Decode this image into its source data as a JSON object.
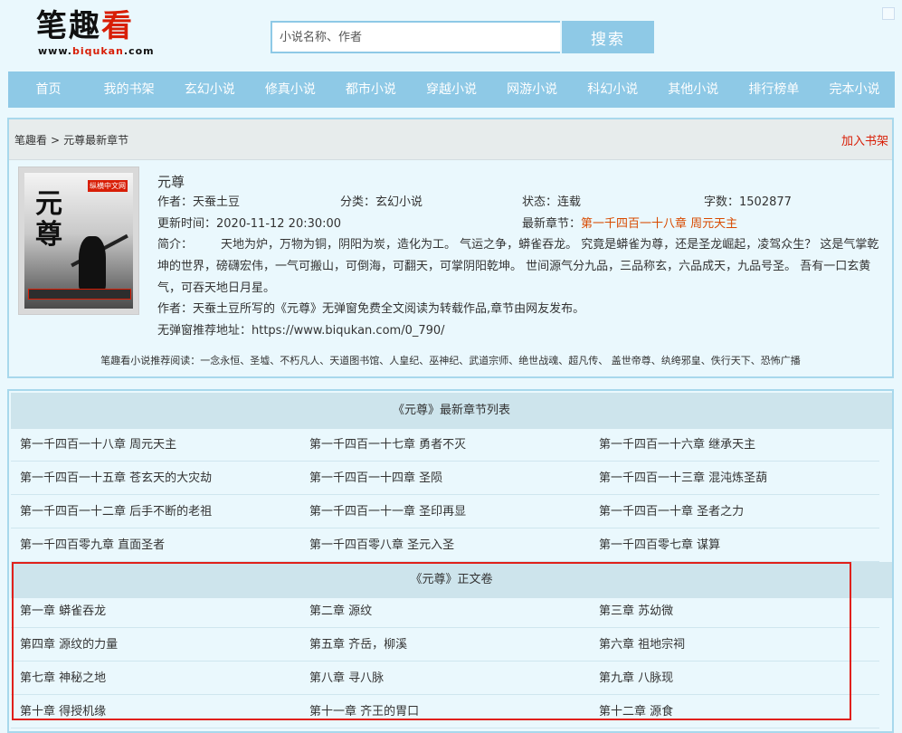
{
  "logo": {
    "cn_part1": "笔趣",
    "cn_part2": "看",
    "url_part1": "www.",
    "url_part2": "biqukan",
    "url_part3": ".com"
  },
  "search": {
    "placeholder": "小说名称、作者",
    "button": "搜索"
  },
  "nav": [
    "首页",
    "我的书架",
    "玄幻小说",
    "修真小说",
    "都市小说",
    "穿越小说",
    "网游小说",
    "科幻小说",
    "其他小说",
    "排行榜单",
    "完本小说"
  ],
  "breadcrumb": {
    "home": "笔趣看",
    "separator": ">",
    "current": "元尊最新章节"
  },
  "add_shelf": "加入书架",
  "book": {
    "cover_title": "元尊",
    "cover_badge": "纵横中文网",
    "title": "元尊",
    "author": "作者：天蚕土豆",
    "category": "分类：玄幻小说",
    "status": "状态：连载",
    "word_count": "字数：1502877",
    "update_time": "更新时间：2020-11-12 20:30:00",
    "latest_label": "最新章节：",
    "latest_chapter": "第一千四百一十八章 周元天主",
    "intro_label": "简介：",
    "intro_text": "天地为炉，万物为铜，阴阳为炭，造化为工。 气运之争，蟒雀吞龙。 究竟是蟒雀为尊，还是圣龙崛起，凌驾众生？ 这是气掌乾坤的世界，磅礴宏伟，一气可搬山，可倒海，可翻天，可掌阴阳乾坤。 世间源气分九品，三品称玄，六品成天，九品号圣。 吾有一口玄黄气，可吞天地日月星。",
    "author_note": "作者：天蚕土豆所写的《元尊》无弹窗免费全文阅读为转载作品,章节由网友发布。",
    "recommend_url": "无弹窗推荐地址：https://www.biqukan.com/0_790/"
  },
  "recommend": "笔趣看小说推荐阅读：一念永恒、圣墟、不朽凡人、天道图书馆、人皇纪、巫神纪、武道宗师、绝世战魂、超凡传、 盖世帝尊、纨绔邪皇、佚行天下、恐怖广播",
  "latest_section": {
    "title": "《元尊》最新章节列表",
    "chapters": [
      "第一千四百一十八章 周元天主",
      "第一千四百一十七章 勇者不灭",
      "第一千四百一十六章 继承天主",
      "第一千四百一十五章 苍玄天的大灾劫",
      "第一千四百一十四章 圣陨",
      "第一千四百一十三章 混沌炼圣葫",
      "第一千四百一十二章 后手不断的老祖",
      "第一千四百一十一章 圣印再显",
      "第一千四百一十章 圣者之力",
      "第一千四百零九章 直面圣者",
      "第一千四百零八章 圣元入圣",
      "第一千四百零七章 谋算"
    ]
  },
  "main_section": {
    "title": "《元尊》正文卷",
    "chapters": [
      "第一章 蟒雀吞龙",
      "第二章 源纹",
      "第三章 苏幼微",
      "第四章 源纹的力量",
      "第五章 齐岳，柳溪",
      "第六章 祖地宗祠",
      "第七章 神秘之地",
      "第八章 寻八脉",
      "第九章 八脉现",
      "第十章 得授机缘",
      "第十一章 齐王的胃口",
      "第十二章 源食"
    ]
  },
  "colors": {
    "accent": "#8ec9e6",
    "link_red": "#d81e06",
    "latest_orange": "#d84a00",
    "highlight": "#e0201b"
  }
}
